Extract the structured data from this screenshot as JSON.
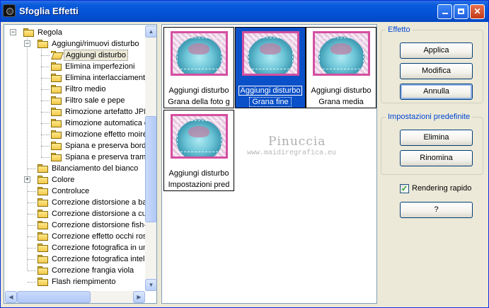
{
  "window": {
    "title": "Sfoglia Effetti"
  },
  "tree": {
    "items": [
      {
        "label": "Regola",
        "level": 0,
        "expander": "−",
        "open": false
      },
      {
        "label": "Aggiungi/rimuovi disturbo",
        "level": 1,
        "expander": "−",
        "open": false
      },
      {
        "label": "Aggiungi disturbo",
        "level": 2,
        "open": true,
        "selected": true
      },
      {
        "label": "Elimina imperfezioni",
        "level": 2
      },
      {
        "label": "Elimina interlacciamento",
        "level": 2
      },
      {
        "label": "Filtro medio",
        "level": 2
      },
      {
        "label": "Filtro sale e pepe",
        "level": 2
      },
      {
        "label": "Rimozione artefatto JPEG",
        "level": 2
      },
      {
        "label": "Rimozione automatica disturbo",
        "level": 2
      },
      {
        "label": "Rimozione effetto moiré",
        "level": 2
      },
      {
        "label": "Spiana e preserva bordi",
        "level": 2
      },
      {
        "label": "Spiana e preserva trama",
        "level": 2
      },
      {
        "label": "Bilanciamento del bianco",
        "level": 1
      },
      {
        "label": "Colore",
        "level": 1,
        "expander": "+"
      },
      {
        "label": "Controluce",
        "level": 1
      },
      {
        "label": "Correzione distorsione a barilotto",
        "level": 1
      },
      {
        "label": "Correzione distorsione a cuscinetto",
        "level": 1
      },
      {
        "label": "Correzione distorsione fish-eye",
        "level": 1
      },
      {
        "label": "Correzione effetto occhi rossi",
        "level": 1
      },
      {
        "label": "Correzione fotografica in un passaggio",
        "level": 1
      },
      {
        "label": "Correzione fotografica intelligente",
        "level": 1
      },
      {
        "label": "Correzione frangia viola",
        "level": 1
      },
      {
        "label": "Flash riempimento",
        "level": 1
      }
    ],
    "scroll_up": "▲",
    "scroll_down": "▼",
    "scroll_left": "◀",
    "scroll_right": "▶"
  },
  "gallery": {
    "cards": [
      {
        "name": "Aggiungi disturbo",
        "preset": "Grana della foto g",
        "selected": false
      },
      {
        "name": "Aggiungi disturbo",
        "preset": "Grana fine",
        "selected": true
      },
      {
        "name": "Aggiungi disturbo",
        "preset": "Grana media",
        "selected": false
      },
      {
        "name": "Aggiungi disturbo",
        "preset": "Impostazioni pred",
        "selected": false
      }
    ],
    "watermark_name": "Pinuccia",
    "watermark_url": "www.maidiregrafica.eu"
  },
  "effetto": {
    "title": "Effetto",
    "apply_label": "Applica",
    "modify_label": "Modifica",
    "cancel_label": "Annulla"
  },
  "presets": {
    "title": "Impostazioni predefinite",
    "delete_label": "Elimina",
    "rename_label": "Rinomina"
  },
  "options": {
    "fast_render_label": "Rendering rapido",
    "fast_render_checked": true,
    "help_label": "?"
  },
  "colors": {
    "titlebar": "#0352d6",
    "selection": "#0a50c8",
    "group_title": "#0046d5"
  }
}
